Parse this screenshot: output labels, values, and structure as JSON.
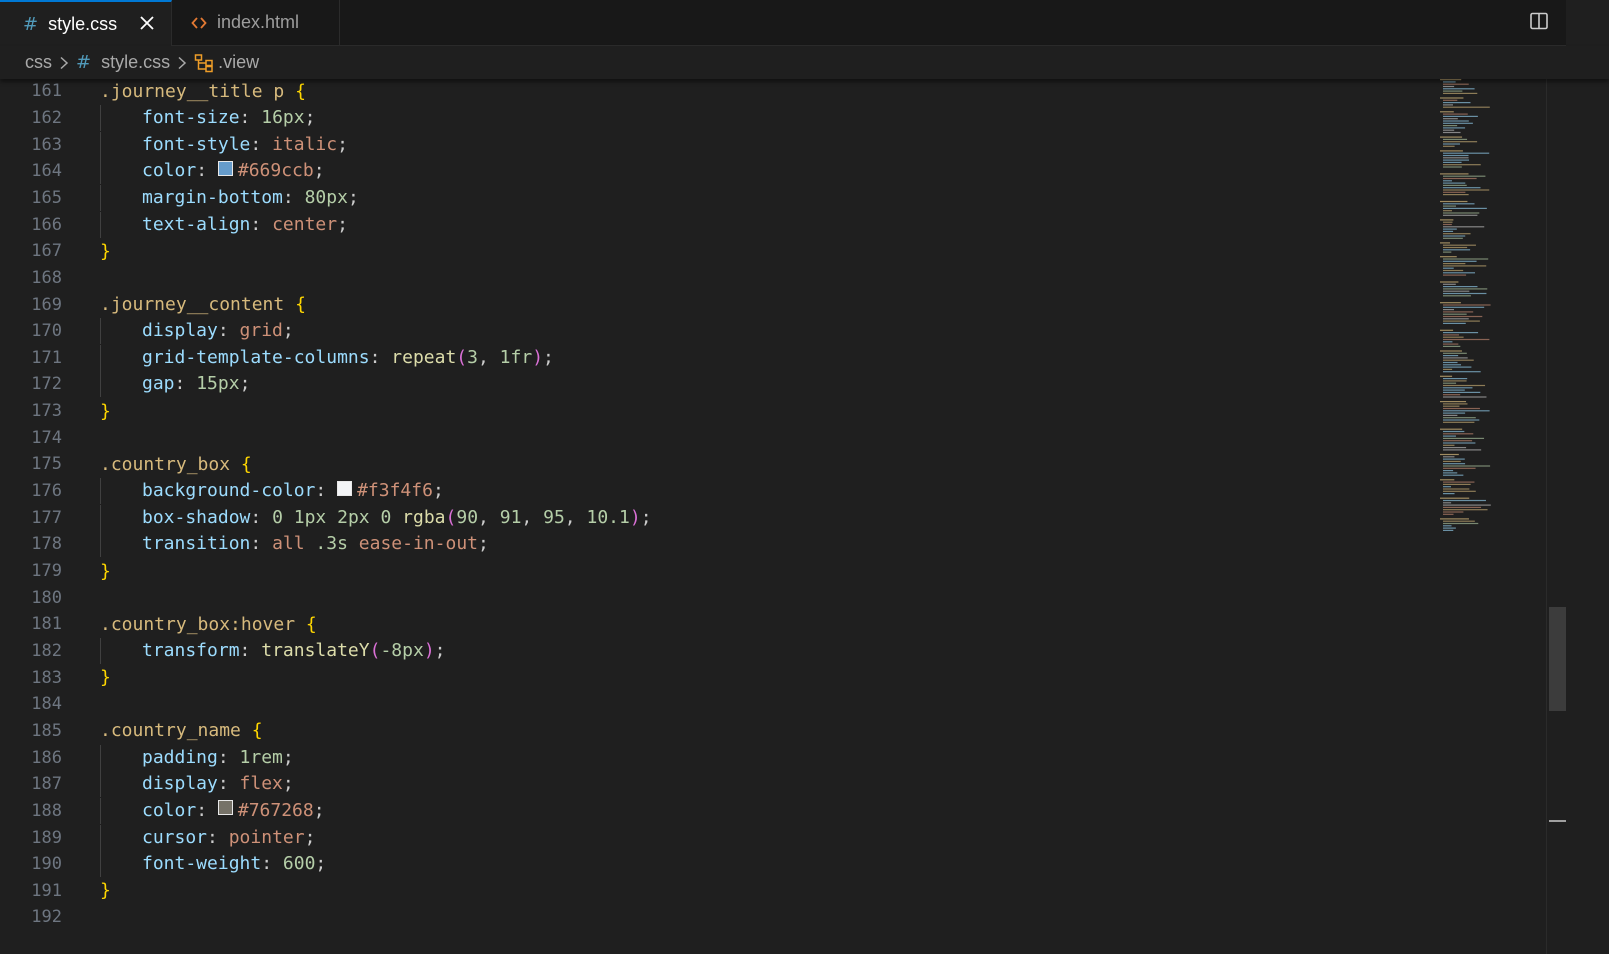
{
  "tabs": [
    {
      "label": "style.css",
      "icon": "css-file-icon",
      "active": true
    },
    {
      "label": "index.html",
      "icon": "html-file-icon",
      "active": false
    }
  ],
  "breadcrumb": {
    "folder": "css",
    "file": "style.css",
    "symbol": ".view"
  },
  "colors": {
    "accent": "#0078d4",
    "selector": "#d7ba7d",
    "property": "#9cdcfe",
    "value": "#ce9178",
    "number": "#b5cea8",
    "function": "#dcdcaa",
    "bracket1": "#ffd700",
    "bracket2": "#da70d6"
  },
  "editor": {
    "lines": [
      {
        "n": "161",
        "indent": 0,
        "tokens": [
          [
            "sel",
            ".journey__title p "
          ],
          [
            "b1",
            "{"
          ]
        ]
      },
      {
        "n": "162",
        "indent": 1,
        "tokens": [
          [
            "prop",
            "font-size"
          ],
          [
            "punc",
            ": "
          ],
          [
            "num",
            "16px"
          ],
          [
            "punc",
            ";"
          ]
        ]
      },
      {
        "n": "163",
        "indent": 1,
        "tokens": [
          [
            "prop",
            "font-style"
          ],
          [
            "punc",
            ": "
          ],
          [
            "val",
            "italic"
          ],
          [
            "punc",
            ";"
          ]
        ]
      },
      {
        "n": "164",
        "indent": 1,
        "tokens": [
          [
            "prop",
            "color"
          ],
          [
            "punc",
            ": "
          ],
          [
            "swatch",
            "#669ccb"
          ],
          [
            "val",
            "#669ccb"
          ],
          [
            "punc",
            ";"
          ]
        ]
      },
      {
        "n": "165",
        "indent": 1,
        "tokens": [
          [
            "prop",
            "margin-bottom"
          ],
          [
            "punc",
            ": "
          ],
          [
            "num",
            "80px"
          ],
          [
            "punc",
            ";"
          ]
        ]
      },
      {
        "n": "166",
        "indent": 1,
        "tokens": [
          [
            "prop",
            "text-align"
          ],
          [
            "punc",
            ": "
          ],
          [
            "val",
            "center"
          ],
          [
            "punc",
            ";"
          ]
        ]
      },
      {
        "n": "167",
        "indent": 0,
        "tokens": [
          [
            "b1",
            "}"
          ]
        ]
      },
      {
        "n": "168",
        "indent": 0,
        "tokens": []
      },
      {
        "n": "169",
        "indent": 0,
        "tokens": [
          [
            "sel",
            ".journey__content "
          ],
          [
            "b1",
            "{"
          ]
        ]
      },
      {
        "n": "170",
        "indent": 1,
        "tokens": [
          [
            "prop",
            "display"
          ],
          [
            "punc",
            ": "
          ],
          [
            "val",
            "grid"
          ],
          [
            "punc",
            ";"
          ]
        ]
      },
      {
        "n": "171",
        "indent": 1,
        "tokens": [
          [
            "prop",
            "grid-template-columns"
          ],
          [
            "punc",
            ": "
          ],
          [
            "fn",
            "repeat"
          ],
          [
            "b2",
            "("
          ],
          [
            "num",
            "3"
          ],
          [
            "punc",
            ", "
          ],
          [
            "num",
            "1fr"
          ],
          [
            "b2",
            ")"
          ],
          [
            "punc",
            ";"
          ]
        ]
      },
      {
        "n": "172",
        "indent": 1,
        "tokens": [
          [
            "prop",
            "gap"
          ],
          [
            "punc",
            ": "
          ],
          [
            "num",
            "15px"
          ],
          [
            "punc",
            ";"
          ]
        ]
      },
      {
        "n": "173",
        "indent": 0,
        "tokens": [
          [
            "b1",
            "}"
          ]
        ]
      },
      {
        "n": "174",
        "indent": 0,
        "tokens": []
      },
      {
        "n": "175",
        "indent": 0,
        "tokens": [
          [
            "sel",
            ".country_box "
          ],
          [
            "b1",
            "{"
          ]
        ]
      },
      {
        "n": "176",
        "indent": 1,
        "tokens": [
          [
            "prop",
            "background-color"
          ],
          [
            "punc",
            ": "
          ],
          [
            "swatch",
            "#f3f4f6"
          ],
          [
            "val",
            "#f3f4f6"
          ],
          [
            "punc",
            ";"
          ]
        ]
      },
      {
        "n": "177",
        "indent": 1,
        "tokens": [
          [
            "prop",
            "box-shadow"
          ],
          [
            "punc",
            ": "
          ],
          [
            "num",
            "0"
          ],
          [
            "punc",
            " "
          ],
          [
            "num",
            "1px"
          ],
          [
            "punc",
            " "
          ],
          [
            "num",
            "2px"
          ],
          [
            "punc",
            " "
          ],
          [
            "num",
            "0"
          ],
          [
            "punc",
            " "
          ],
          [
            "fn",
            "rgba"
          ],
          [
            "b2",
            "("
          ],
          [
            "num",
            "90"
          ],
          [
            "punc",
            ", "
          ],
          [
            "num",
            "91"
          ],
          [
            "punc",
            ", "
          ],
          [
            "num",
            "95"
          ],
          [
            "punc",
            ", "
          ],
          [
            "num",
            "10.1"
          ],
          [
            "b2",
            ")"
          ],
          [
            "punc",
            ";"
          ]
        ]
      },
      {
        "n": "178",
        "indent": 1,
        "tokens": [
          [
            "prop",
            "transition"
          ],
          [
            "punc",
            ": "
          ],
          [
            "val",
            "all"
          ],
          [
            "punc",
            " "
          ],
          [
            "num",
            ".3s"
          ],
          [
            "punc",
            " "
          ],
          [
            "val",
            "ease-in-out"
          ],
          [
            "punc",
            ";"
          ]
        ]
      },
      {
        "n": "179",
        "indent": 0,
        "tokens": [
          [
            "b1",
            "}"
          ]
        ]
      },
      {
        "n": "180",
        "indent": 0,
        "tokens": []
      },
      {
        "n": "181",
        "indent": 0,
        "tokens": [
          [
            "sel",
            ".country_box:hover "
          ],
          [
            "b1",
            "{"
          ]
        ]
      },
      {
        "n": "182",
        "indent": 1,
        "tokens": [
          [
            "prop",
            "transform"
          ],
          [
            "punc",
            ": "
          ],
          [
            "fn",
            "translateY"
          ],
          [
            "b2",
            "("
          ],
          [
            "num",
            "-8px"
          ],
          [
            "b2",
            ")"
          ],
          [
            "punc",
            ";"
          ]
        ]
      },
      {
        "n": "183",
        "indent": 0,
        "tokens": [
          [
            "b1",
            "}"
          ]
        ]
      },
      {
        "n": "184",
        "indent": 0,
        "tokens": []
      },
      {
        "n": "185",
        "indent": 0,
        "tokens": [
          [
            "sel",
            ".country_name "
          ],
          [
            "b1",
            "{"
          ]
        ]
      },
      {
        "n": "186",
        "indent": 1,
        "tokens": [
          [
            "prop",
            "padding"
          ],
          [
            "punc",
            ": "
          ],
          [
            "num",
            "1rem"
          ],
          [
            "punc",
            ";"
          ]
        ]
      },
      {
        "n": "187",
        "indent": 1,
        "tokens": [
          [
            "prop",
            "display"
          ],
          [
            "punc",
            ": "
          ],
          [
            "val",
            "flex"
          ],
          [
            "punc",
            ";"
          ]
        ]
      },
      {
        "n": "188",
        "indent": 1,
        "tokens": [
          [
            "prop",
            "color"
          ],
          [
            "punc",
            ": "
          ],
          [
            "swatch",
            "#767268"
          ],
          [
            "val",
            "#767268"
          ],
          [
            "punc",
            ";"
          ]
        ]
      },
      {
        "n": "189",
        "indent": 1,
        "tokens": [
          [
            "prop",
            "cursor"
          ],
          [
            "punc",
            ": "
          ],
          [
            "val",
            "pointer"
          ],
          [
            "punc",
            ";"
          ]
        ]
      },
      {
        "n": "190",
        "indent": 1,
        "tokens": [
          [
            "prop",
            "font-weight"
          ],
          [
            "punc",
            ": "
          ],
          [
            "num",
            "600"
          ],
          [
            "punc",
            ";"
          ]
        ]
      },
      {
        "n": "191",
        "indent": 0,
        "tokens": [
          [
            "b1",
            "}"
          ]
        ]
      },
      {
        "n": "192",
        "indent": 0,
        "tokens": []
      }
    ]
  }
}
